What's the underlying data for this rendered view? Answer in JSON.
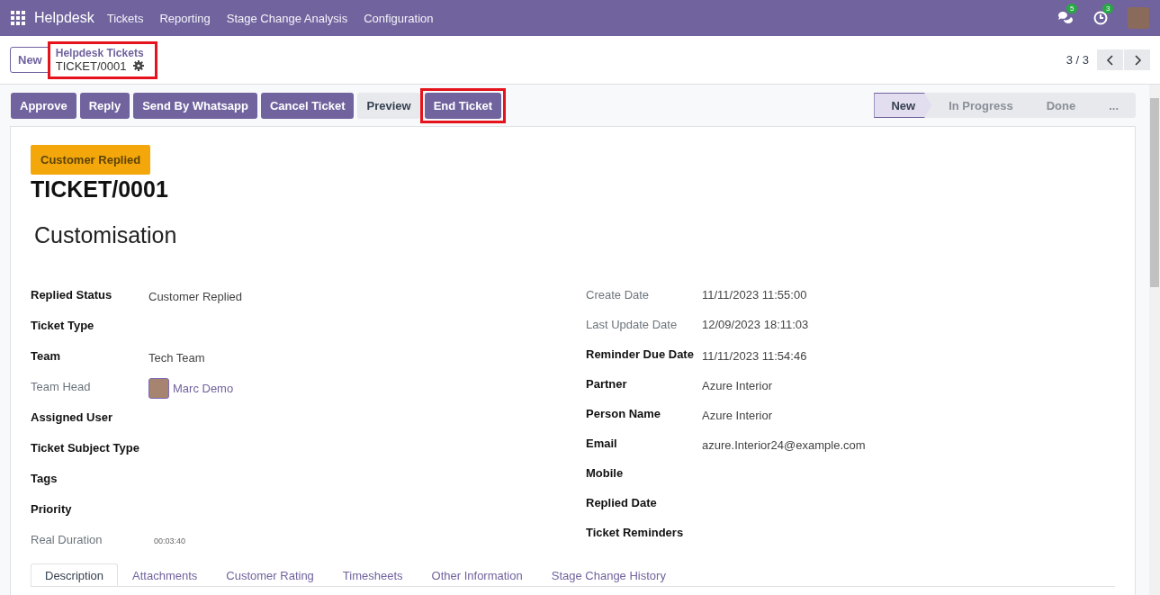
{
  "navbar": {
    "app": "Helpdesk",
    "menu": [
      "Tickets",
      "Reporting",
      "Stage Change Analysis",
      "Configuration"
    ],
    "messages_count": "5",
    "activities_count": "3"
  },
  "control_panel": {
    "new_button": "New",
    "breadcrumb": {
      "parent": "Helpdesk Tickets",
      "current": "TICKET/0001",
      "highlighted": true
    },
    "pager": "3 / 3"
  },
  "actions": [
    {
      "label": "Approve",
      "kind": "primary",
      "highlighted": false
    },
    {
      "label": "Reply",
      "kind": "primary",
      "highlighted": false
    },
    {
      "label": "Send By Whatsapp",
      "kind": "primary",
      "highlighted": false
    },
    {
      "label": "Cancel Ticket",
      "kind": "primary",
      "highlighted": false
    },
    {
      "label": "Preview",
      "kind": "secondary",
      "highlighted": false
    },
    {
      "label": "End Ticket",
      "kind": "primary",
      "highlighted": true
    }
  ],
  "stages": [
    {
      "label": "New",
      "selected": true
    },
    {
      "label": "In Progress",
      "selected": false
    },
    {
      "label": "Done",
      "selected": false
    },
    {
      "label": "...",
      "selected": false
    }
  ],
  "form": {
    "status_badge": "Customer Replied",
    "ticket_number": "TICKET/0001",
    "subject": "Customisation",
    "left_fields": [
      {
        "label": "Replied Status",
        "value": "Customer Replied",
        "kind": "text",
        "readonly": false
      },
      {
        "label": "Ticket Type",
        "readonly": false
      },
      {
        "label": "Team",
        "value": "Tech Team",
        "kind": "text",
        "readonly": false
      },
      {
        "label": "Team Head",
        "value": "Marc Demo",
        "kind": "user",
        "readonly": true
      },
      {
        "label": "Assigned User",
        "readonly": false
      },
      {
        "label": "Ticket Subject Type",
        "readonly": false
      },
      {
        "label": "Tags",
        "readonly": false
      },
      {
        "label": "Priority",
        "readonly": false
      },
      {
        "label": "Real Duration",
        "value": "00:03:40",
        "kind": "duration",
        "readonly": true
      }
    ],
    "right_fields": [
      {
        "label": "Create Date",
        "value": "11/11/2023 11:55:00",
        "kind": "text",
        "readonly": true
      },
      {
        "label": "Last Update Date",
        "value": "12/09/2023 18:11:03",
        "kind": "text",
        "readonly": true
      },
      {
        "label": "Reminder Due Date",
        "value": "11/11/2023 11:54:46",
        "kind": "text",
        "readonly": false
      },
      {
        "label": "Partner",
        "value": "Azure Interior",
        "kind": "text",
        "readonly": false
      },
      {
        "label": "Person Name",
        "value": "Azure Interior",
        "kind": "text",
        "readonly": false
      },
      {
        "label": "Email",
        "value": "azure.Interior24@example.com",
        "kind": "text",
        "readonly": false
      },
      {
        "label": "Mobile",
        "readonly": false
      },
      {
        "label": "Replied Date",
        "readonly": false
      },
      {
        "label": "Ticket Reminders",
        "readonly": false
      }
    ],
    "tabs": [
      {
        "label": "Description",
        "selected": true
      },
      {
        "label": "Attachments",
        "selected": false
      },
      {
        "label": "Customer Rating",
        "selected": false
      },
      {
        "label": "Timesheets",
        "selected": false
      },
      {
        "label": "Other Information",
        "selected": false
      },
      {
        "label": "Stage Change History",
        "selected": false
      }
    ]
  }
}
